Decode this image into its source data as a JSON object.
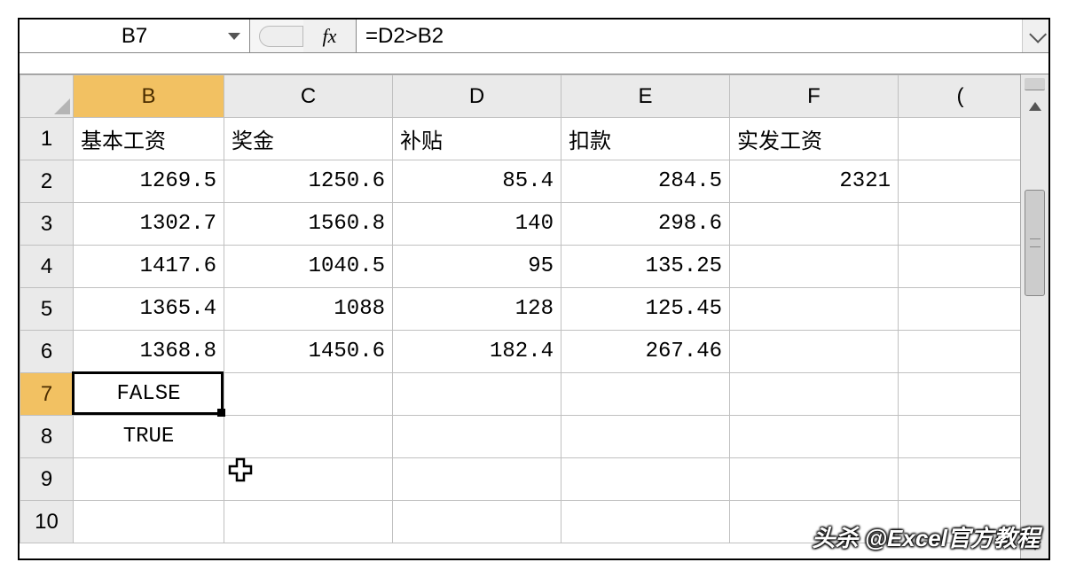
{
  "nameBox": "B7",
  "fxLabel": "fx",
  "formula": "=D2>B2",
  "columns": [
    "B",
    "C",
    "D",
    "E",
    "F",
    "("
  ],
  "rowNumbers": [
    "1",
    "2",
    "3",
    "4",
    "5",
    "6",
    "7",
    "8",
    "9",
    "10"
  ],
  "activeColumn": "B",
  "activeRow": "7",
  "headers": {
    "B": "基本工资",
    "C": "奖金",
    "D": "补贴",
    "E": "扣款",
    "F": "实发工资"
  },
  "rows": {
    "2": {
      "B": "1269.5",
      "C": "1250.6",
      "D": "85.4",
      "E": "284.5",
      "F": "2321"
    },
    "3": {
      "B": "1302.7",
      "C": "1560.8",
      "D": "140",
      "E": "298.6"
    },
    "4": {
      "B": "1417.6",
      "C": "1040.5",
      "D": "95",
      "E": "135.25"
    },
    "5": {
      "B": "1365.4",
      "C": "1088",
      "D": "128",
      "E": "125.45"
    },
    "6": {
      "B": "1368.8",
      "C": "1450.6",
      "D": "182.4",
      "E": "267.46"
    },
    "7": {
      "B": "FALSE"
    },
    "8": {
      "B": "TRUE"
    }
  },
  "watermark": "头杀 @Excel官方教程"
}
